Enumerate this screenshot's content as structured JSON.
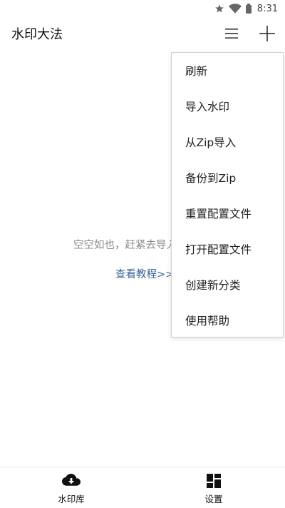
{
  "status_bar": {
    "time": "8:31",
    "icons": [
      "star-icon",
      "wifi-icon",
      "battery-icon"
    ]
  },
  "app_bar": {
    "title": "水印大法",
    "actions": [
      "menu-lines-icon",
      "plus-icon"
    ]
  },
  "main": {
    "empty_message": "空空如也，赶紧去导入",
    "tutorial_link": "查看教程>>"
  },
  "popup_menu": {
    "items": [
      {
        "label": "刷新"
      },
      {
        "label": "导入水印"
      },
      {
        "label": "从Zip导入"
      },
      {
        "label": "备份到Zip"
      },
      {
        "label": "重置配置文件"
      },
      {
        "label": "打开配置文件"
      },
      {
        "label": "创建新分类"
      },
      {
        "label": "使用帮助"
      }
    ]
  },
  "bottom_nav": {
    "items": [
      {
        "label": "水印库",
        "icon": "cloud-download-icon"
      },
      {
        "label": "设置",
        "icon": "dashboard-grid-icon"
      }
    ]
  },
  "colors": {
    "link": "#3c6496",
    "muted_text": "#8a8a8a",
    "menu_border": "#cfcfcf"
  }
}
